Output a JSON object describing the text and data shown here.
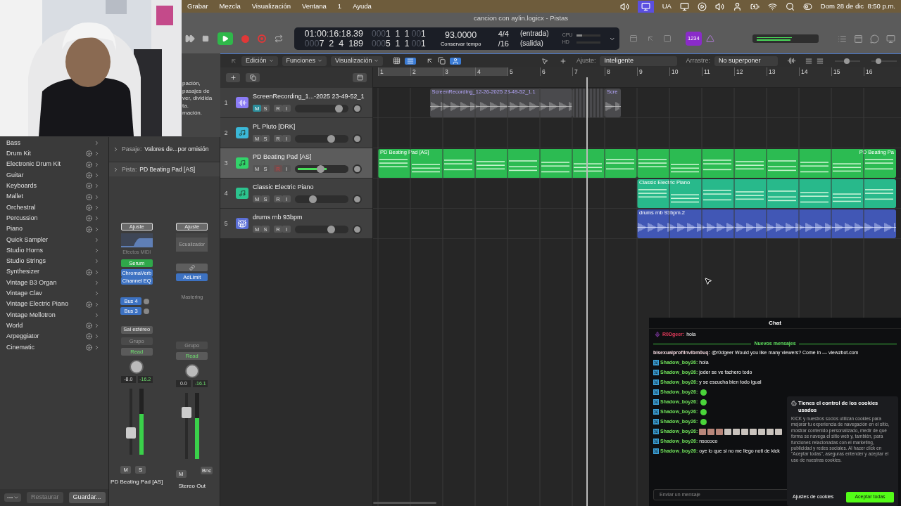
{
  "menu_bar": {
    "items": [
      "Grabar",
      "Mezcla",
      "Visualización",
      "Ventana",
      "1",
      "Ayuda"
    ],
    "keyboard": "UA",
    "clock": "Dom 28 de dic  8:50 p.m."
  },
  "window": {
    "title": "cancion con aylin.logicx - Pistas"
  },
  "webcam": {
    "kind": "picture"
  },
  "transport": {
    "playing": true,
    "smpte": "01:00:16:18.39",
    "position": {
      "dim": "000",
      "main": "7  2  4  189"
    },
    "locator_in": {
      "dim": "000",
      "main": "1  1  1",
      "dim2": "00",
      "tick": "1"
    },
    "locator_out": {
      "dim": "000",
      "main": "5  1  1",
      "dim2": "00",
      "tick": "1"
    },
    "tempo": "93.0000",
    "tempo_mode": "Conservar tempo",
    "signature": "4/4",
    "division": "/16",
    "input": "(entrada)",
    "output": "(salida)",
    "cpu_label": "CPU",
    "hd_label": "HD",
    "count_in": "1234"
  },
  "edit_toolbar": {
    "menus": [
      "Edición",
      "Funciones",
      "Visualización"
    ],
    "snap_label": "Ajuste:",
    "snap": "Inteligente",
    "drag_label": "Arrastre:",
    "drag": "No superponer",
    "vertical_zoom": {
      "level": 0.45
    },
    "horizontal_zoom": {
      "level": 0.2
    }
  },
  "hint": [
    "pación,",
    "pasajes de",
    "ver, dividida",
    "ta.",
    "mación."
  ],
  "library": {
    "items": [
      {
        "name": "Bass",
        "downloadable": false
      },
      {
        "name": "Drum Kit",
        "downloadable": true
      },
      {
        "name": "Electronic Drum Kit",
        "downloadable": true
      },
      {
        "name": "Guitar",
        "downloadable": true
      },
      {
        "name": "Keyboards",
        "downloadable": true
      },
      {
        "name": "Mallet",
        "downloadable": true
      },
      {
        "name": "Orchestral",
        "downloadable": true
      },
      {
        "name": "Percussion",
        "downloadable": true
      },
      {
        "name": "Piano",
        "downloadable": true
      },
      {
        "name": "Quick Sampler",
        "downloadable": false
      },
      {
        "name": "Studio Horns",
        "downloadable": false
      },
      {
        "name": "Studio Strings",
        "downloadable": false
      },
      {
        "name": "Synthesizer",
        "downloadable": true
      },
      {
        "name": "Vintage B3 Organ",
        "downloadable": false
      },
      {
        "name": "Vintage Clav",
        "downloadable": false
      },
      {
        "name": "Vintage Electric Piano",
        "downloadable": true
      },
      {
        "name": "Vintage Mellotron",
        "downloadable": false
      },
      {
        "name": "World",
        "downloadable": true
      },
      {
        "name": "Arpeggiator",
        "downloadable": true
      },
      {
        "name": "Cinematic",
        "downloadable": true
      }
    ],
    "restore": {
      "label": "Restaurar",
      "disabled": true
    },
    "save": "Guardar..."
  },
  "inspector": {
    "region_label": "Pasaje:",
    "region_value": "Valores de...por omisión",
    "track_label": "Pista:",
    "track_value": "PD Beating Pad [AS]"
  },
  "strips": [
    {
      "setting": "Ajuste",
      "eq": {
        "kind": "curve"
      },
      "midi_fx": "Efectos MIDI",
      "instrument": {
        "kind": "plugin",
        "name": "Serum"
      },
      "effects": [
        "ChromaVerb",
        "Channel EQ"
      ],
      "sends": [
        "Bus 4",
        "Bus 3"
      ],
      "output": "Sal estéreo",
      "group": "Grupo",
      "automation": "Read",
      "pan": "-8.0",
      "peak": "-16.2",
      "fader": {
        "level": 0.3
      },
      "meter": {
        "level": 0.62
      },
      "buttons": [
        "M",
        "S"
      ],
      "name": "PD Beating Pad [AS]"
    },
    {
      "setting": "Ajuste",
      "eq": {
        "kind": "label",
        "label": "Ecualizador"
      },
      "instrument": {
        "kind": "link"
      },
      "effects": [
        "AdLimit"
      ],
      "mastering": "Mastering",
      "group": "Grupo",
      "automation": "Read",
      "pan": "0.0",
      "peak": "-16.1",
      "fader": {
        "level": 0.75
      },
      "meter": {
        "level": 0.62
      },
      "bounce": "Bnc",
      "buttons": [
        "M"
      ],
      "name": "Stereo Out"
    }
  ],
  "ruler": {
    "bars": [
      "1",
      "2",
      "3",
      "4",
      "5",
      "6",
      "7",
      "8",
      "9",
      "10",
      "11",
      "12",
      "13",
      "14",
      "15",
      "16"
    ]
  },
  "tracks": [
    {
      "number": "1",
      "name": "ScreenRecording_1...-2025 23-49-52_1",
      "kind": "audio",
      "color": "#8b7cf6",
      "selected": false,
      "level": 0.87,
      "buttons": [
        {
          "kind": "mute",
          "label": "M",
          "on": true
        },
        {
          "kind": "solo",
          "label": "S",
          "on": false
        },
        {
          "kind": "record",
          "label": "R",
          "on": false
        },
        {
          "kind": "input",
          "label": "I",
          "on": false
        }
      ],
      "regions": [
        {
          "kind": "audio",
          "name": "ScreenRecording_12-26-2025 23-49-52_1.1",
          "color": "#4a4a4d"
        },
        {
          "kind": "slices",
          "color": "#4a4a4d"
        },
        {
          "kind": "audio",
          "name": "Scre",
          "color": "#4a4a4d"
        }
      ]
    },
    {
      "number": "2",
      "name": "PL Pluto [DRK]",
      "kind": "instrument",
      "color": "#3bb8d8",
      "selected": false,
      "level": 0.7,
      "buttons": [
        {
          "kind": "mute",
          "label": "M",
          "on": false
        },
        {
          "kind": "solo",
          "label": "S",
          "on": false
        },
        {
          "kind": "record",
          "label": "R",
          "on": false
        },
        {
          "kind": "input",
          "label": "I",
          "on": false
        }
      ]
    },
    {
      "number": "3",
      "name": "PD Beating Pad [AS]",
      "kind": "instrument",
      "color": "#32d36a",
      "selected": true,
      "level": 0.47,
      "meter": {
        "level": 0.6
      },
      "buttons": [
        {
          "kind": "mute",
          "label": "M",
          "on": false
        },
        {
          "kind": "solo",
          "label": "S",
          "on": false
        },
        {
          "kind": "record",
          "label": "R",
          "on": true
        },
        {
          "kind": "input",
          "label": "I",
          "on": false
        }
      ],
      "regions": [
        {
          "kind": "midi",
          "name": "PD Beating Pad [AS]",
          "color": "#2cbb52"
        },
        {
          "kind": "midi",
          "name": "PD Beating Pa",
          "color": "#2cbb52"
        }
      ]
    },
    {
      "number": "4",
      "name": "Classic Electric Piano",
      "kind": "instrument",
      "color": "#2cc38e",
      "selected": false,
      "level": 0.3,
      "buttons": [
        {
          "kind": "mute",
          "label": "M",
          "on": false
        },
        {
          "kind": "solo",
          "label": "S",
          "on": false
        },
        {
          "kind": "record",
          "label": "R",
          "on": false
        },
        {
          "kind": "input",
          "label": "I",
          "on": false
        }
      ],
      "regions": [
        {
          "kind": "midi",
          "name": "Classic Electric Piano",
          "color": "#28b98b"
        }
      ]
    },
    {
      "number": "5",
      "name": "drums rnb 93bpm",
      "kind": "drums",
      "color": "#5b6fd6",
      "selected": false,
      "level": 0.7,
      "buttons": [
        {
          "kind": "mute",
          "label": "M",
          "on": false
        },
        {
          "kind": "solo",
          "label": "S",
          "on": false
        },
        {
          "kind": "record",
          "label": "R",
          "on": false
        },
        {
          "kind": "input",
          "label": "I",
          "on": false
        }
      ],
      "regions": [
        {
          "kind": "audio",
          "name": "drums rnb 93bpm.2",
          "color": "#4157b5"
        }
      ]
    }
  ],
  "chat": {
    "title": "Chat",
    "pinned": {
      "user": "R0Dgeer:",
      "text": "hola"
    },
    "divider": "Nuevos mensajes",
    "messages": [
      {
        "kind": "text",
        "badge": false,
        "user": "bisexualprofilnvlbm0uq:",
        "color": "#f0d6dc",
        "text": "@r0dgeer Would you like many viewers? Come in — viewzbot.com"
      },
      {
        "kind": "text",
        "badge": true,
        "user": "Shadow_boy26:",
        "color": "#6fe05a",
        "text": "hola"
      },
      {
        "kind": "text",
        "badge": true,
        "user": "Shadow_boy26:",
        "color": "#6fe05a",
        "text": "joder se ve fachero todo"
      },
      {
        "kind": "text",
        "badge": true,
        "user": "Shadow_boy26:",
        "color": "#6fe05a",
        "text": "y se escucha bien todo igual"
      },
      {
        "kind": "emote",
        "badge": true,
        "user": "Shadow_boy26:",
        "color": "#6fe05a"
      },
      {
        "kind": "emote",
        "badge": true,
        "user": "Shadow_boy26:",
        "color": "#6fe05a"
      },
      {
        "kind": "emote",
        "badge": true,
        "user": "Shadow_boy26:",
        "color": "#6fe05a"
      },
      {
        "kind": "emote",
        "badge": true,
        "user": "Shadow_boy26:",
        "color": "#6fe05a"
      },
      {
        "kind": "emote_row",
        "badge": true,
        "user": "Shadow_boy26:",
        "color": "#6fe05a"
      },
      {
        "kind": "text",
        "badge": true,
        "user": "Shadow_boy26:",
        "color": "#6fe05a",
        "text": "nsococo"
      },
      {
        "kind": "text",
        "badge": true,
        "user": "Shadow_boy26:",
        "color": "#6fe05a",
        "text": "oye lo que si no me llego noti de kick"
      }
    ],
    "input_placeholder": "Enviar un mensaje"
  },
  "cookies": {
    "title": "Tienes el control de los cookies usados",
    "body": "KICK y nuestros socios utilizan cookies para mejorar tu experiencia de navegación en el sitio, mostrar contenido personalizado, medir de qué forma se navega el sitio web y, también, para funciones relacionadas con el marketing, publicidad y redes sociales. Al hacer click en \"Aceptar todas\", aseguras entender y aceptar el uso de nuestras cookies.",
    "settings": "Ajustes de cookies",
    "accept": "Aceptar todas"
  }
}
